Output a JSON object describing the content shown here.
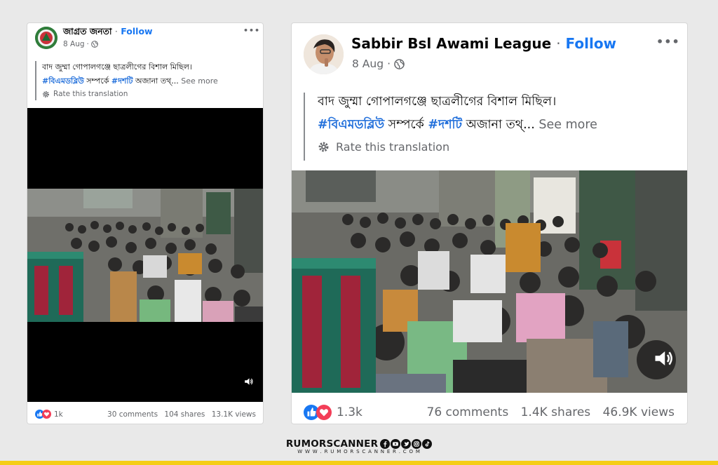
{
  "post_left": {
    "author": "জাগ্রত জনতা",
    "separator": "·",
    "follow_label": "Follow",
    "date": "8 Aug",
    "meta_separator": "·",
    "more_label": "•••",
    "text_line1": "বাদ জুম্মা গোপালগঞ্জে ছাত্রলীগের বিশাল মিছিল।",
    "hashtag1": "#বিএমডব্লিউ",
    "text_mid": " সম্পর্কে ",
    "hashtag2": "#দশটি",
    "text_tail": " অজানা তথ্... ",
    "see_more": "See more",
    "rate_translation": "Rate this translation",
    "reactions_count": "1k",
    "comments": "30 comments",
    "shares": "104 shares",
    "views": "13.1K views"
  },
  "post_right": {
    "author": "Sabbir Bsl Awami League",
    "separator": "·",
    "follow_label": "Follow",
    "date": "8 Aug",
    "meta_separator": "·",
    "more_label": "•••",
    "text_line1": "বাদ জুম্মা গোপালগঞ্জে ছাত্রলীগের বিশাল মিছিল।",
    "hashtag1": "#বিএমডব্লিউ",
    "text_mid": " সম্পর্কে ",
    "hashtag2": "#দশটি",
    "text_tail": " অজানা তথ্... ",
    "see_more": "See more",
    "rate_translation": "Rate this translation",
    "reactions_count": "1.3k",
    "comments": "76 comments",
    "shares": "1.4K shares",
    "views": "46.9K views"
  },
  "branding": {
    "name": "RUMORSCANNER",
    "url": "W W W . R U M O R S C A N N E R . C O M",
    "social_icons": [
      "facebook-icon",
      "youtube-icon",
      "twitter-icon",
      "instagram-icon",
      "tiktok-icon"
    ]
  },
  "colors": {
    "follow": "#1877f2",
    "hashtag": "#216fdb",
    "like": "#1877f2",
    "love": "#f33e58",
    "accent_bar": "#f5cd16"
  }
}
